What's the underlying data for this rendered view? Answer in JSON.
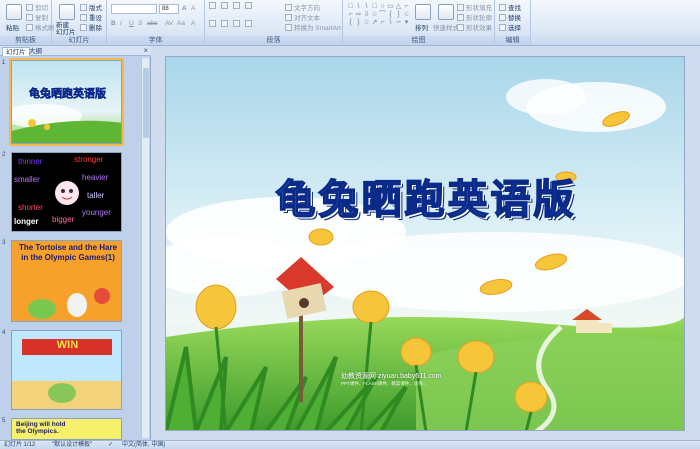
{
  "ribbon": {
    "clipboard": {
      "paste_label": "粘贴",
      "cut_label": "剪切",
      "copy_label": "复制",
      "format_painter_label": "格式刷",
      "group_label": "剪贴板"
    },
    "slides": {
      "new_slide_label": "新建\n幻灯片",
      "layout_label": "版式",
      "reset_label": "重设",
      "delete_label": "删除",
      "group_label": "幻灯片"
    },
    "font": {
      "font_size_value": "88",
      "group_label": "字体"
    },
    "paragraph": {
      "text_direction_label": "文字方向",
      "align_text_label": "对齐文本",
      "smartart_label": "转换为 SmartArt",
      "group_label": "段落"
    },
    "drawing": {
      "arrange_label": "排列",
      "quick_styles_label": "快速样式",
      "shape_fill_label": "形状填充",
      "shape_outline_label": "形状轮廓",
      "shape_effects_label": "形状效果",
      "group_label": "绘图"
    },
    "editing": {
      "find_label": "查找",
      "replace_label": "替换",
      "select_label": "选择",
      "group_label": "编辑"
    }
  },
  "left_pane": {
    "tabs": [
      {
        "label": "幻灯片"
      },
      {
        "label": "大纲"
      }
    ],
    "close": "×",
    "slides": [
      {
        "number": "1",
        "title": "龟兔晒跑英语版",
        "selected": true
      },
      {
        "number": "2",
        "words": [
          "thinner",
          "stronger",
          "smaller",
          "heavier",
          "taller",
          "shorter",
          "younger",
          "longer",
          "bigger"
        ]
      },
      {
        "number": "3",
        "text": "The Tortoise and the Hare in the Olympic Games(1)"
      },
      {
        "number": "4",
        "banner": "WIN"
      },
      {
        "number": "5",
        "text": "Beijing will hold the Olympics."
      }
    ]
  },
  "slide": {
    "title": "龟兔晒跑英语版",
    "watermark": "幼教资源网 ziyuan.baby611.com",
    "watermark_sub": "PPT课件、FLASH课件、教案课件、试卷..."
  },
  "status_bar": {
    "slide_counter": "幻灯片 1/12",
    "theme": "\"默认设计模板\"",
    "language": "中文(简体, 中国)"
  },
  "colors": {
    "sky_top": "#bfe3f0",
    "grass": "#5fb534",
    "title_fill": "#3a7fe0",
    "title_outline": "#0a2a8a",
    "selection": "#f6b84a"
  }
}
